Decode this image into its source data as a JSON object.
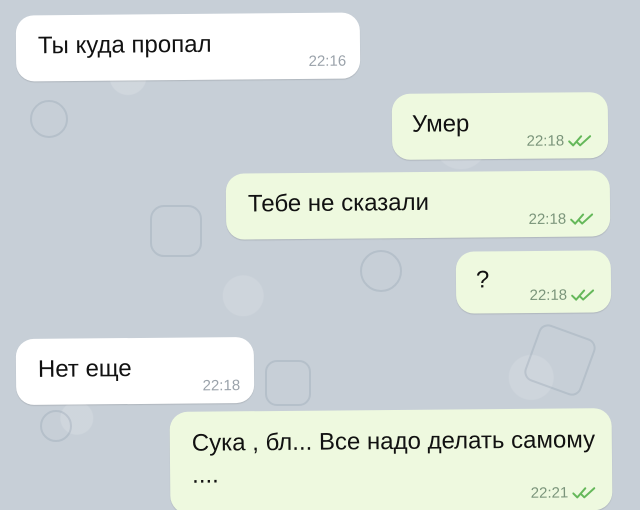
{
  "messages": [
    {
      "type": "incoming",
      "text": "Ты куда пропал",
      "time": "22:16"
    },
    {
      "type": "outgoing",
      "text": "Умер",
      "time": "22:18",
      "status_icon": "double-check-icon",
      "status_color": "#65b85a"
    },
    {
      "type": "outgoing",
      "text": "Тебе не сказали",
      "time": "22:18",
      "status_icon": "double-check-icon",
      "status_color": "#65b85a"
    },
    {
      "type": "outgoing",
      "text": "?",
      "time": "22:18",
      "status_icon": "double-check-icon",
      "status_color": "#65b85a"
    },
    {
      "type": "incoming",
      "text": "Нет еще",
      "time": "22:18"
    },
    {
      "type": "outgoing",
      "text": "Сука , бл... Все надо делать самому ....",
      "time": "22:21",
      "status_icon": "double-check-icon",
      "status_color": "#65b85a"
    }
  ],
  "colors": {
    "background": "#c7cfd7",
    "incoming_bubble": "#ffffff",
    "outgoing_bubble": "#eef9df"
  }
}
